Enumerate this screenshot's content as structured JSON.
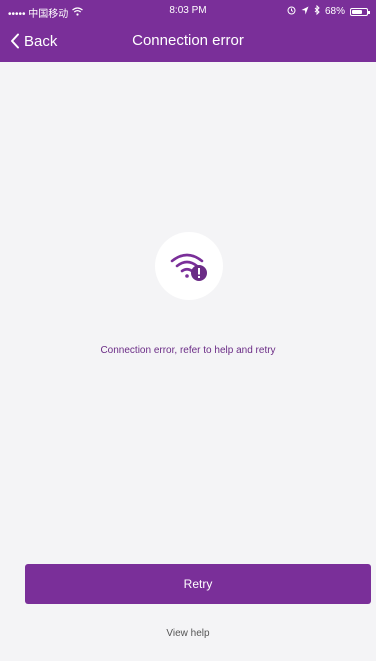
{
  "status_bar": {
    "carrier": "••••• 中国移动",
    "time": "8:03 PM",
    "battery": "68%",
    "battery_level": 0.68,
    "icons": [
      "wifi-icon",
      "location-icon",
      "alarm-icon",
      "bluetooth-icon",
      "battery-icon"
    ]
  },
  "nav": {
    "back_label": "Back",
    "title": "Connection error"
  },
  "main": {
    "icon": "wifi-error-icon",
    "message": "Connection error, refer to help and retry"
  },
  "actions": {
    "retry_label": "Retry",
    "help_label": "View help"
  },
  "colors": {
    "primary": "#7a2f99",
    "background": "#f4f4f6",
    "message_text": "#6b2c86"
  }
}
